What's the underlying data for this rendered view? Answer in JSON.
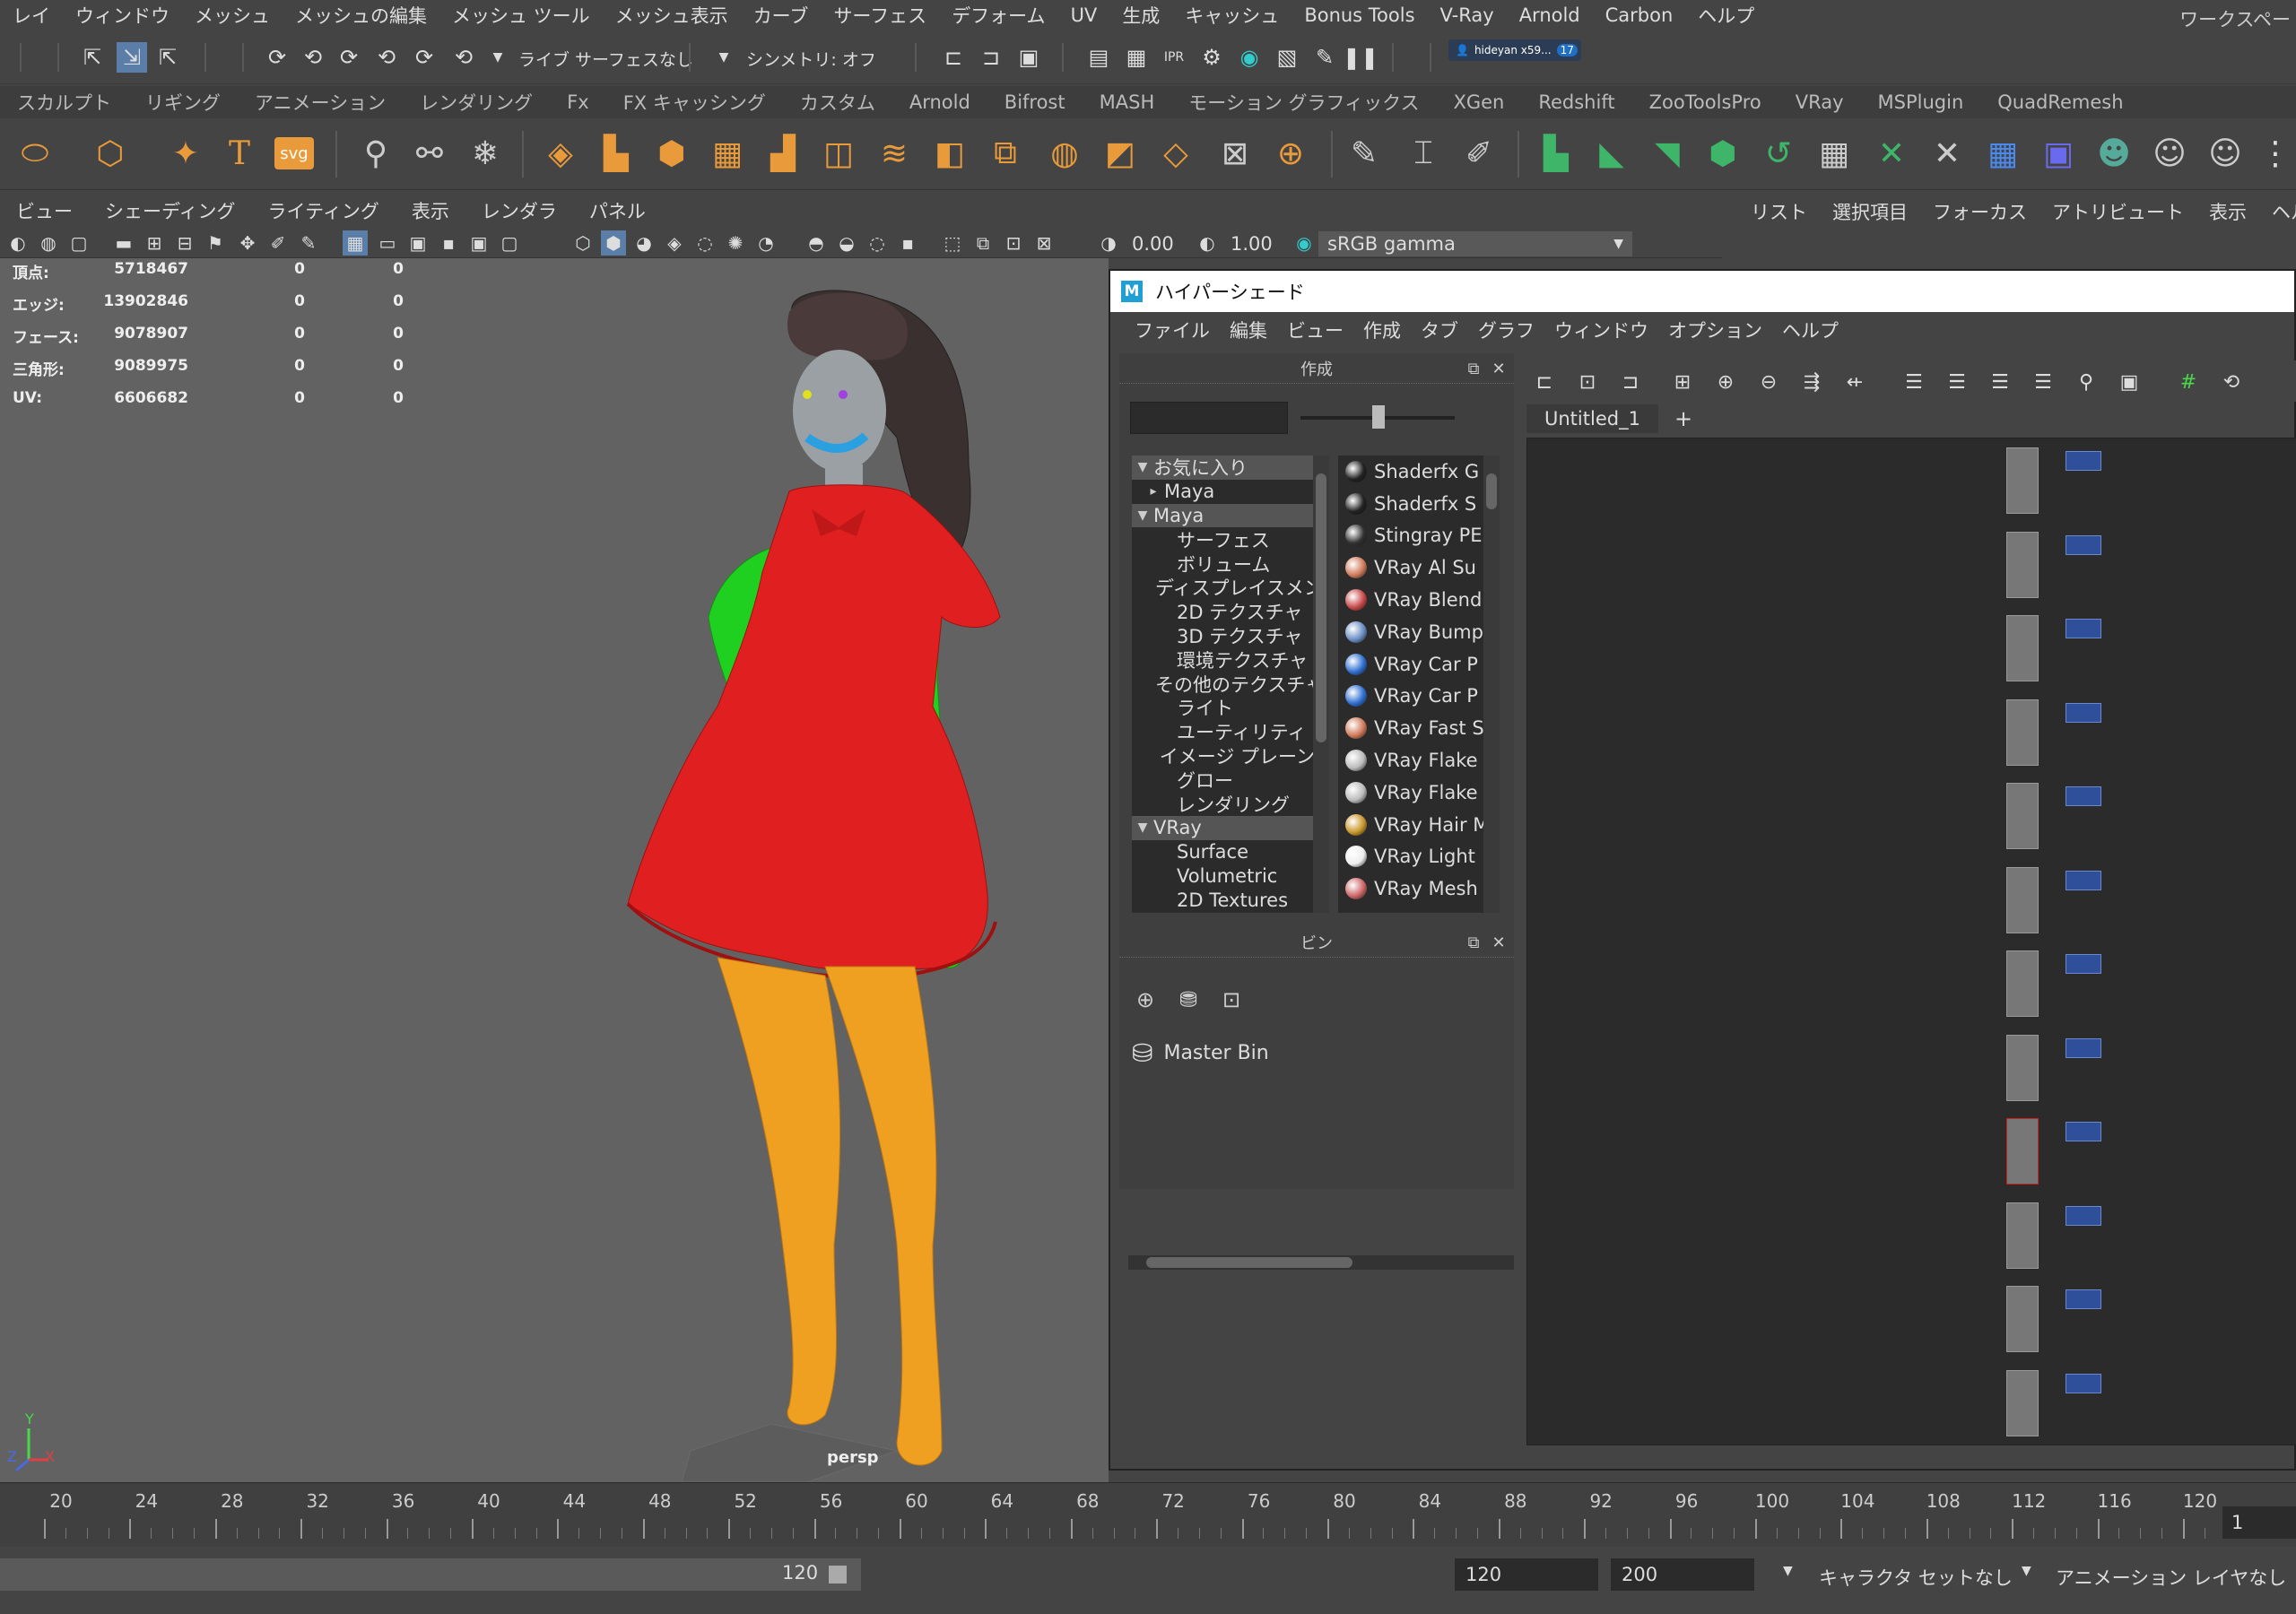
{
  "menubar": {
    "items": [
      "レイ",
      "ウィンドウ",
      "メッシュ",
      "メッシュの編集",
      "メッシュ ツール",
      "メッシュ表示",
      "カーブ",
      "サーフェス",
      "デフォーム",
      "UV",
      "生成",
      "キャッシュ",
      "Bonus Tools",
      "V-Ray",
      "Arnold",
      "Carbon",
      "ヘルプ"
    ],
    "workspace": "ワークスペー"
  },
  "statusline": {
    "live_surface": "ライブ サーフェスなし",
    "symmetry": "シンメトリ: オフ",
    "user": "hideyan x59...",
    "notifications": "17"
  },
  "shelf_tabs": [
    "スカルプト",
    "リギング",
    "アニメーション",
    "レンダリング",
    "Fx",
    "FX キャッシング",
    "カスタム",
    "Arnold",
    "Bifrost",
    "MASH",
    "モーション グラフィックス",
    "XGen",
    "Redshift",
    "ZooToolsPro",
    "VRay",
    "MSPlugin",
    "QuadRemesh"
  ],
  "shelf": {
    "svg_label": "svg",
    "text_label": "T"
  },
  "panel_menu": [
    "ビュー",
    "シェーディング",
    "ライティング",
    "表示",
    "レンダラ",
    "パネル"
  ],
  "panel_toolbar": {
    "exposure": "0.00",
    "gamma": "1.00",
    "colorspace": "sRGB gamma"
  },
  "attr_menu": [
    "リスト",
    "選択項目",
    "フォーカス",
    "アトリビュート",
    "表示",
    "ヘルプ"
  ],
  "hud": {
    "rows": [
      {
        "label": "頂点:",
        "v1": "5718467",
        "v2": "0",
        "v3": "0"
      },
      {
        "label": "エッジ:",
        "v1": "13902846",
        "v2": "0",
        "v3": "0"
      },
      {
        "label": "フェース:",
        "v1": "9078907",
        "v2": "0",
        "v3": "0"
      },
      {
        "label": "三角形:",
        "v1": "9089975",
        "v2": "0",
        "v3": "0"
      },
      {
        "label": "UV:",
        "v1": "6606682",
        "v2": "0",
        "v3": "0"
      }
    ],
    "camera": "persp"
  },
  "hypershade": {
    "title": "ハイパーシェード",
    "menu": [
      "ファイル",
      "編集",
      "ビュー",
      "作成",
      "タブ",
      "グラフ",
      "ウィンドウ",
      "オプション",
      "ヘルプ"
    ],
    "create_panel_title": "作成",
    "tree": [
      {
        "label": "お気に入り",
        "arrow": "▼",
        "indent": 0,
        "highlight": true
      },
      {
        "label": "Maya",
        "arrow": "▸",
        "indent": 1,
        "highlight": false
      },
      {
        "label": "Maya",
        "arrow": "▼",
        "indent": 0,
        "highlight": true
      },
      {
        "label": "サーフェス",
        "arrow": "",
        "indent": 1,
        "highlight": false
      },
      {
        "label": "ボリューム",
        "arrow": "",
        "indent": 1,
        "highlight": false
      },
      {
        "label": "ディスプレイスメント",
        "arrow": "",
        "indent": 1,
        "highlight": false
      },
      {
        "label": "2D テクスチャ",
        "arrow": "",
        "indent": 1,
        "highlight": false
      },
      {
        "label": "3D テクスチャ",
        "arrow": "",
        "indent": 1,
        "highlight": false
      },
      {
        "label": "環境テクスチャ",
        "arrow": "",
        "indent": 1,
        "highlight": false
      },
      {
        "label": "その他のテクスチャ",
        "arrow": "",
        "indent": 1,
        "highlight": false
      },
      {
        "label": "ライト",
        "arrow": "",
        "indent": 1,
        "highlight": false
      },
      {
        "label": "ユーティリティ",
        "arrow": "",
        "indent": 1,
        "highlight": false
      },
      {
        "label": "イメージ プレーン",
        "arrow": "",
        "indent": 1,
        "highlight": false
      },
      {
        "label": "グロー",
        "arrow": "",
        "indent": 1,
        "highlight": false
      },
      {
        "label": "レンダリング",
        "arrow": "",
        "indent": 1,
        "highlight": false
      },
      {
        "label": "VRay",
        "arrow": "▼",
        "indent": 0,
        "highlight": true
      },
      {
        "label": "Surface",
        "arrow": "",
        "indent": 1,
        "highlight": false
      },
      {
        "label": "Volumetric",
        "arrow": "",
        "indent": 1,
        "highlight": false
      },
      {
        "label": "2D Textures",
        "arrow": "",
        "indent": 1,
        "highlight": false
      }
    ],
    "nodes": [
      {
        "label": "Shaderfx G",
        "color": "#222"
      },
      {
        "label": "Shaderfx S",
        "color": "#222"
      },
      {
        "label": "Stingray PE",
        "color": "#333"
      },
      {
        "label": "VRay Al Su",
        "color": "#d07a5a"
      },
      {
        "label": "VRay Blend",
        "color": "#c84a4a"
      },
      {
        "label": "VRay Bump",
        "color": "#6a8fc4"
      },
      {
        "label": "VRay Car P",
        "color": "#2f6fd0"
      },
      {
        "label": "VRay Car P",
        "color": "#2f6fd0"
      },
      {
        "label": "VRay Fast S",
        "color": "#d07a5a"
      },
      {
        "label": "VRay Flake",
        "color": "#bbbbbb"
      },
      {
        "label": "VRay Flake",
        "color": "#bbbbbb"
      },
      {
        "label": "VRay Hair M",
        "color": "#c8962a"
      },
      {
        "label": "VRay Light",
        "color": "#eeeeee"
      },
      {
        "label": "VRay Mesh",
        "color": "#cc6666"
      }
    ],
    "bin_panel_title": "ビン",
    "master_bin": "Master Bin",
    "graph_tab": "Untitled_1",
    "graph_tab_add": "+"
  },
  "timeslider": {
    "ticks": [
      "20",
      "24",
      "28",
      "32",
      "36",
      "40",
      "44",
      "48",
      "52",
      "56",
      "60",
      "64",
      "68",
      "72",
      "76",
      "80",
      "84",
      "88",
      "92",
      "96",
      "100",
      "104",
      "108",
      "112",
      "116",
      "120"
    ],
    "current_frame": "1"
  },
  "range": {
    "end_display": "120",
    "anim_end": "120",
    "scene_end": "200",
    "character_set": "キャラクタ セットなし",
    "anim_layer": "アニメーション レイヤなし"
  },
  "colors": {
    "accent": "#e99a3a",
    "shelf_green": "#3fb56a",
    "dress": "#e02020",
    "skin_legs": "#f0a020",
    "arms": "#20d020"
  }
}
